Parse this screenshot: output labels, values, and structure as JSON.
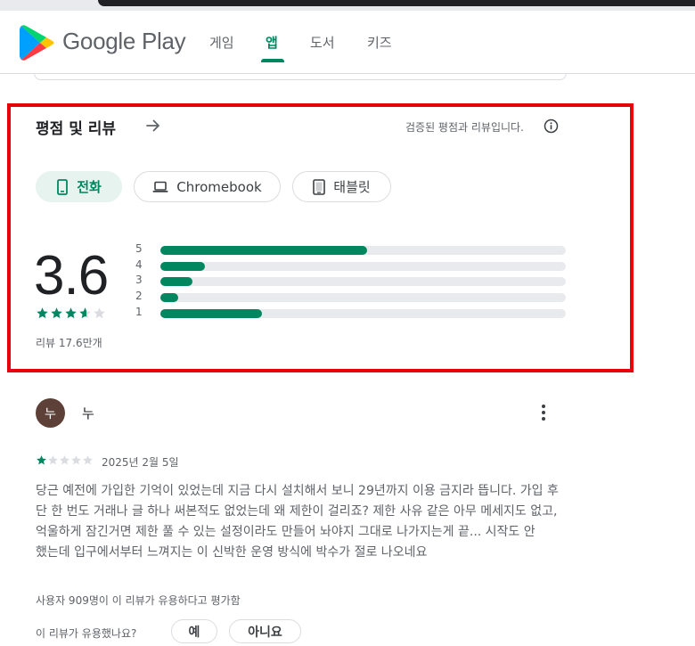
{
  "header": {
    "logo_text": "Google Play",
    "nav": [
      {
        "label": "게임",
        "active": false
      },
      {
        "label": "앱",
        "active": true
      },
      {
        "label": "도서",
        "active": false
      },
      {
        "label": "키즈",
        "active": false
      }
    ]
  },
  "ratings": {
    "title": "평점 및 리뷰",
    "verified_text": "검증된 평점과 리뷰입니다.",
    "device_tabs": [
      {
        "label": "전화",
        "icon": "phone-icon",
        "active": true
      },
      {
        "label": "Chromebook",
        "icon": "laptop-icon",
        "active": false
      },
      {
        "label": "태블릿",
        "icon": "tablet-icon",
        "active": false
      }
    ],
    "score": "3.6",
    "star_value": 3.6,
    "review_count": "리뷰 17.6만개",
    "distribution": [
      {
        "label": "5",
        "fraction": 0.51
      },
      {
        "label": "4",
        "fraction": 0.11
      },
      {
        "label": "3",
        "fraction": 0.08
      },
      {
        "label": "2",
        "fraction": 0.045
      },
      {
        "label": "1",
        "fraction": 0.25
      }
    ]
  },
  "review": {
    "avatar_letter": "누",
    "author": "누",
    "stars": 1,
    "date": "2025년 2월 5일",
    "text": "당근 예전에 가입한 기억이 있었는데 지금 다시 설치해서 보니 29년까지 이용 금지라 뜹니다. 가입 후 단 한 번도 거래나 글 하나 써본적도 없었는데 왜 제한이 걸리죠? 제한 사유 같은 아무 메세지도 없고, 억울하게 잠긴거면 제한 풀 수 있는 설정이라도 만들어 놔야지 그대로 나가지는게 끝... 시작도 안 했는데 입구에서부터 느껴지는 이 신박한 운영 방식에 박수가 절로 나오네요",
    "helpful_count": "사용자 909명이 이 리뷰가 유용하다고 평가함",
    "helpful_question": "이 리뷰가 유용했나요?",
    "yes_label": "예",
    "no_label": "아니요"
  },
  "colors": {
    "accent": "#01875f",
    "highlight": "#e8000b",
    "track": "#e8eaed"
  }
}
